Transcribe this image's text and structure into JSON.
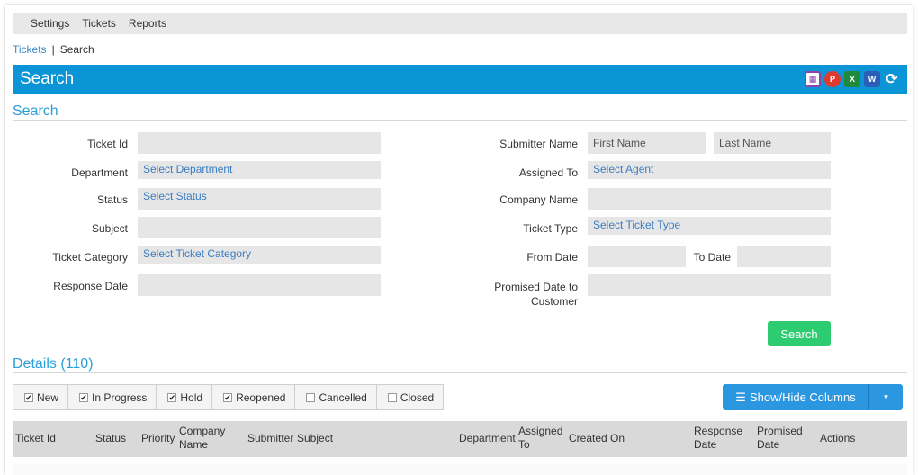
{
  "menu": {
    "items": [
      "Settings",
      "Tickets",
      "Reports"
    ]
  },
  "breadcrumb": {
    "parent": "Tickets",
    "current": "Search"
  },
  "header": {
    "title": "Search",
    "tools": [
      "calendar-icon",
      "pdf-icon",
      "excel-icon",
      "word-icon",
      "refresh-icon"
    ]
  },
  "search_section": {
    "title": "Search"
  },
  "form": {
    "ticket_id_label": "Ticket Id",
    "department_label": "Department",
    "department_value": "Select Department",
    "status_label": "Status",
    "status_value": "Select Status",
    "subject_label": "Subject",
    "category_label": "Ticket Category",
    "category_value": "Select Ticket Category",
    "response_date_label": "Response Date",
    "submitter_label": "Submitter Name",
    "first_name_placeholder": "First Name",
    "last_name_placeholder": "Last Name",
    "assigned_label": "Assigned To",
    "assigned_value": "Select Agent",
    "company_label": "Company Name",
    "type_label": "Ticket Type",
    "type_value": "Select Ticket Type",
    "from_date_label": "From Date",
    "to_date_label": "To Date",
    "promised_label_1": "Promised Date to",
    "promised_label_2": "Customer",
    "search_button": "Search"
  },
  "details": {
    "title": "Details",
    "count": "(110)"
  },
  "filters": [
    {
      "label": "New",
      "checked": true
    },
    {
      "label": "In Progress",
      "checked": true
    },
    {
      "label": "Hold",
      "checked": true
    },
    {
      "label": "Reopened",
      "checked": true
    },
    {
      "label": "Cancelled",
      "checked": false
    },
    {
      "label": "Closed",
      "checked": false
    }
  ],
  "columns_button": "Show/Hide Columns",
  "table": {
    "headers": [
      [
        "Ticket Id"
      ],
      [
        "Status"
      ],
      [
        "Priority"
      ],
      [
        "Company",
        "Name"
      ],
      [
        "Submitter"
      ],
      [
        "Subject"
      ],
      [
        "Department"
      ],
      [
        "Assigned",
        "To"
      ],
      [
        "Created On"
      ],
      [
        "Response",
        "Date"
      ],
      [
        "Promised",
        "Date"
      ],
      [
        "Actions"
      ]
    ]
  },
  "colors": {
    "accent": "#0b95d6",
    "link": "#2a9fd8",
    "success": "#2ecc71",
    "button": "#2a97e0"
  }
}
